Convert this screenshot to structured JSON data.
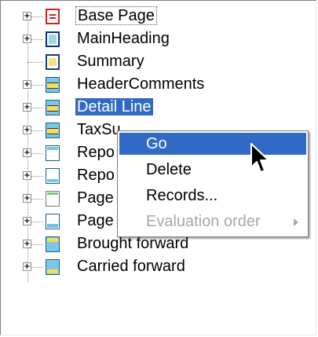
{
  "tree": {
    "items": [
      {
        "label": "Base Page",
        "icon": "page-icon",
        "expander": "+"
      },
      {
        "label": "MainHeading",
        "icon": "section-icon",
        "expander": "+"
      },
      {
        "label": "Summary",
        "icon": "section-icon",
        "expander": ""
      },
      {
        "label": "HeaderComments",
        "icon": "band-icon",
        "expander": "+"
      },
      {
        "label": "Detail Line",
        "icon": "band-icon",
        "expander": "+"
      },
      {
        "label": "TaxSu",
        "icon": "band-icon",
        "expander": "+"
      },
      {
        "label": "Repo",
        "icon": "band-top-icon",
        "expander": "+"
      },
      {
        "label": "Repo",
        "icon": "band-bottom-icon",
        "expander": "+"
      },
      {
        "label": "Page",
        "icon": "page-band-icon",
        "expander": "+"
      },
      {
        "label": "Page footer",
        "icon": "footer-icon",
        "expander": "+"
      },
      {
        "label": "Brought forward",
        "icon": "brought-forward-icon",
        "expander": "+"
      },
      {
        "label": "Carried forward",
        "icon": "carried-forward-icon",
        "expander": "+"
      }
    ],
    "selected_index": 4,
    "focused_index": 0
  },
  "context_menu": {
    "items": [
      {
        "label": "Go",
        "highlighted": true,
        "enabled": true
      },
      {
        "label": "Delete",
        "highlighted": false,
        "enabled": true
      },
      {
        "label": "Records...",
        "highlighted": false,
        "enabled": true
      },
      {
        "label": "Evaluation order",
        "highlighted": false,
        "enabled": false,
        "submenu": true
      }
    ]
  },
  "colors": {
    "selection": "#316ac5",
    "disabled_text": "#a8a8a8",
    "page_icon": "#cc2222",
    "band_blue": "#7cc7e6",
    "band_yellow": "#f5dd5a"
  }
}
